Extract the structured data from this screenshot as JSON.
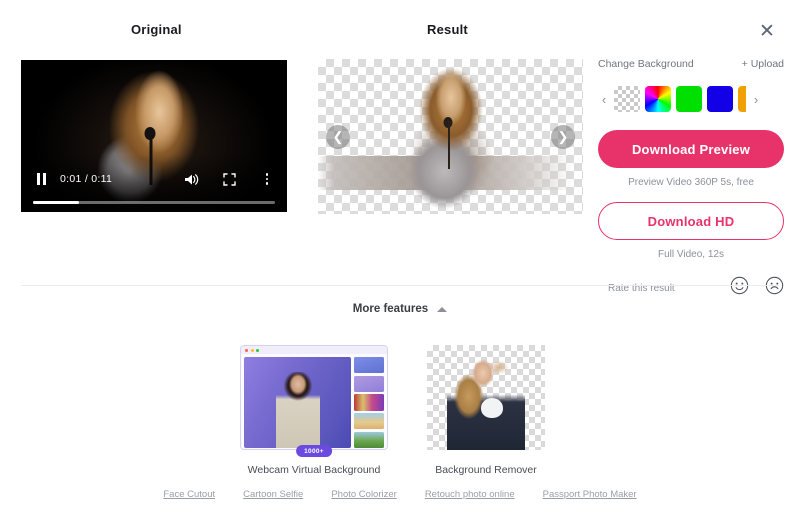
{
  "window": {
    "close_icon": "close-icon"
  },
  "panels": {
    "original_title": "Original",
    "result_title": "Result"
  },
  "video": {
    "pause_icon": "pause-icon",
    "time": "0:01 / 0:11",
    "volume_icon": "volume-icon",
    "fullscreen_icon": "fullscreen-icon",
    "more_icon": "kebab-menu-icon",
    "progress_percent": 19
  },
  "result": {
    "prev_icon": "chevron-left-icon",
    "next_icon": "chevron-right-icon"
  },
  "sidebar": {
    "change_background_label": "Change Background",
    "upload_label": "+ Upload",
    "prev_icon": "chevron-left-icon",
    "next_icon": "chevron-right-icon",
    "swatches": [
      {
        "name": "transparent",
        "color": "transparent"
      },
      {
        "name": "rainbow",
        "color": "#ff0000"
      },
      {
        "name": "green",
        "color": "#00e000"
      },
      {
        "name": "blue",
        "color": "#1400e6"
      },
      {
        "name": "orange",
        "color": "#f0a000"
      }
    ],
    "download_preview_label": "Download Preview",
    "preview_caption": "Preview Video 360P 5s, free",
    "download_hd_label": "Download HD",
    "hd_caption": "Full Video, 12s",
    "rate_label": "Rate this result",
    "rate_happy_icon": "smiley-happy-icon",
    "rate_sad_icon": "smiley-sad-icon",
    "accent_color": "#e8336a"
  },
  "more_features": {
    "label": "More features",
    "caret_icon": "chevron-up-icon",
    "cards": [
      {
        "label": "Webcam Virtual Background",
        "badge": "1000+"
      },
      {
        "label": "Background Remover",
        "badge": ""
      }
    ],
    "links": [
      "Face Cutout",
      "Cartoon Selfie",
      "Photo Colorizer",
      "Retouch photo online",
      "Passport Photo Maker"
    ]
  }
}
